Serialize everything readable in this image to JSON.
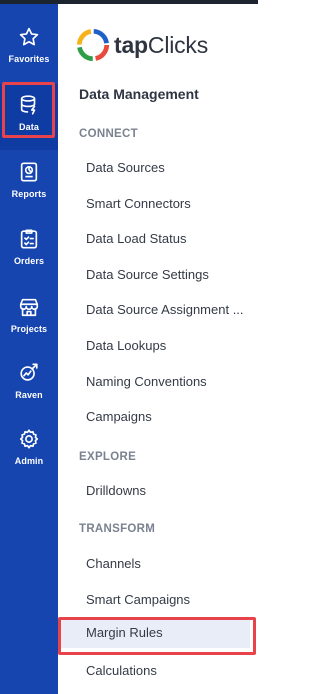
{
  "rail": {
    "items": [
      {
        "label": "Favorites",
        "icon": "star-icon"
      },
      {
        "label": "Data",
        "icon": "database-icon"
      },
      {
        "label": "Reports",
        "icon": "report-icon"
      },
      {
        "label": "Orders",
        "icon": "orders-icon"
      },
      {
        "label": "Projects",
        "icon": "projects-icon"
      },
      {
        "label": "Raven",
        "icon": "raven-icon"
      },
      {
        "label": "Admin",
        "icon": "gear-icon"
      }
    ]
  },
  "brand": {
    "logo_text_bold": "tap",
    "logo_text_rest": "Clicks"
  },
  "menu": {
    "title": "Data Management",
    "sections": [
      {
        "label": "CONNECT",
        "items": [
          "Data Sources",
          "Smart Connectors",
          "Data Load Status",
          "Data Source Settings",
          "Data Source Assignment ...",
          "Data Lookups",
          "Naming Conventions",
          "Campaigns"
        ]
      },
      {
        "label": "EXPLORE",
        "items": [
          "Drilldowns"
        ]
      },
      {
        "label": "TRANSFORM",
        "items": [
          "Channels",
          "Smart Campaigns",
          "Margin Rules",
          "Calculations"
        ]
      }
    ]
  },
  "colors": {
    "rail_bg": "#1645b0",
    "highlight": "#e8424b",
    "selected_bg": "#e9edf7"
  }
}
